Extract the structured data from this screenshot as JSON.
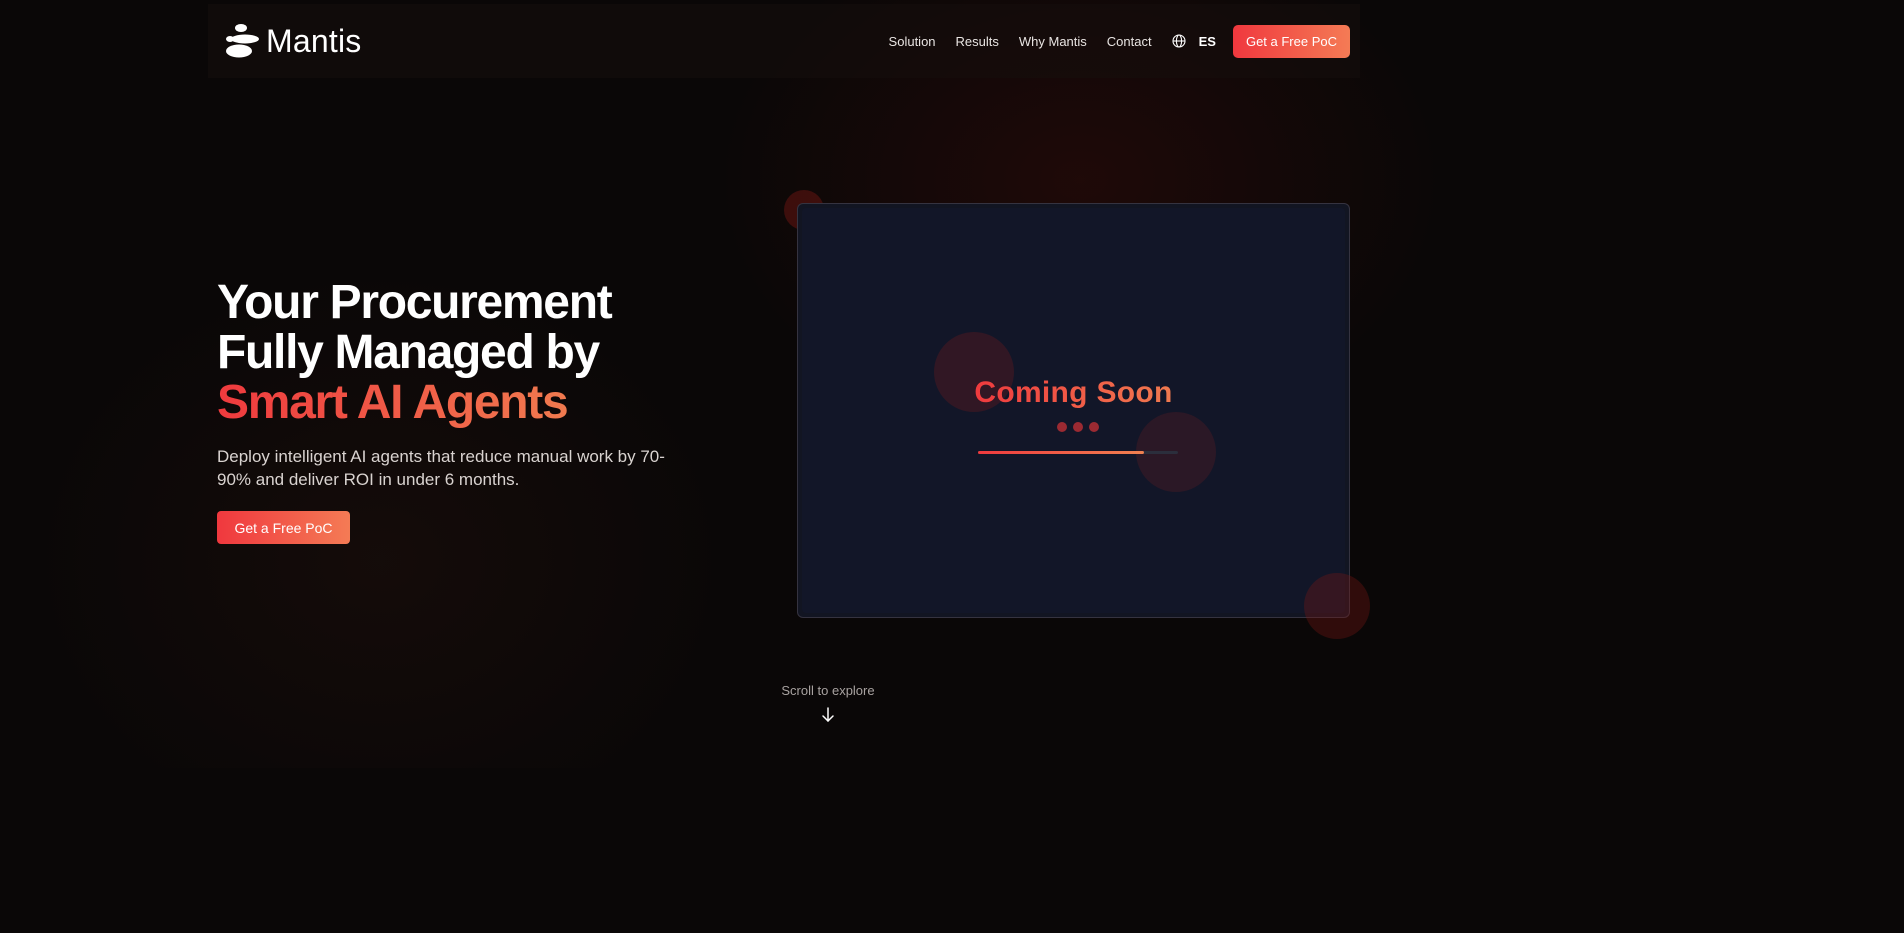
{
  "brand": {
    "name": "Mantis",
    "logo_icon": "stacked-stones-icon"
  },
  "nav": {
    "links": [
      "Solution",
      "Results",
      "Why Mantis",
      "Contact"
    ],
    "language_icon": "globe-icon",
    "language": "ES",
    "cta_label": "Get a Free PoC"
  },
  "hero": {
    "title_line1": "Your Procurement",
    "title_line2": "Fully Managed by",
    "title_accent": "Smart AI Agents",
    "subtitle": "Deploy intelligent AI agents that reduce manual work by 70-90% and deliver ROI in under 6 months.",
    "cta_label": "Get a Free PoC"
  },
  "video_card": {
    "status": "Coming Soon",
    "progress": 0.83
  },
  "scroll": {
    "label": "Scroll to explore",
    "icon": "arrow-down-icon"
  },
  "colors": {
    "accent_start": "#ef3a3e",
    "accent_end": "#f47b55",
    "background": "#0a0707",
    "card": "#121628"
  }
}
